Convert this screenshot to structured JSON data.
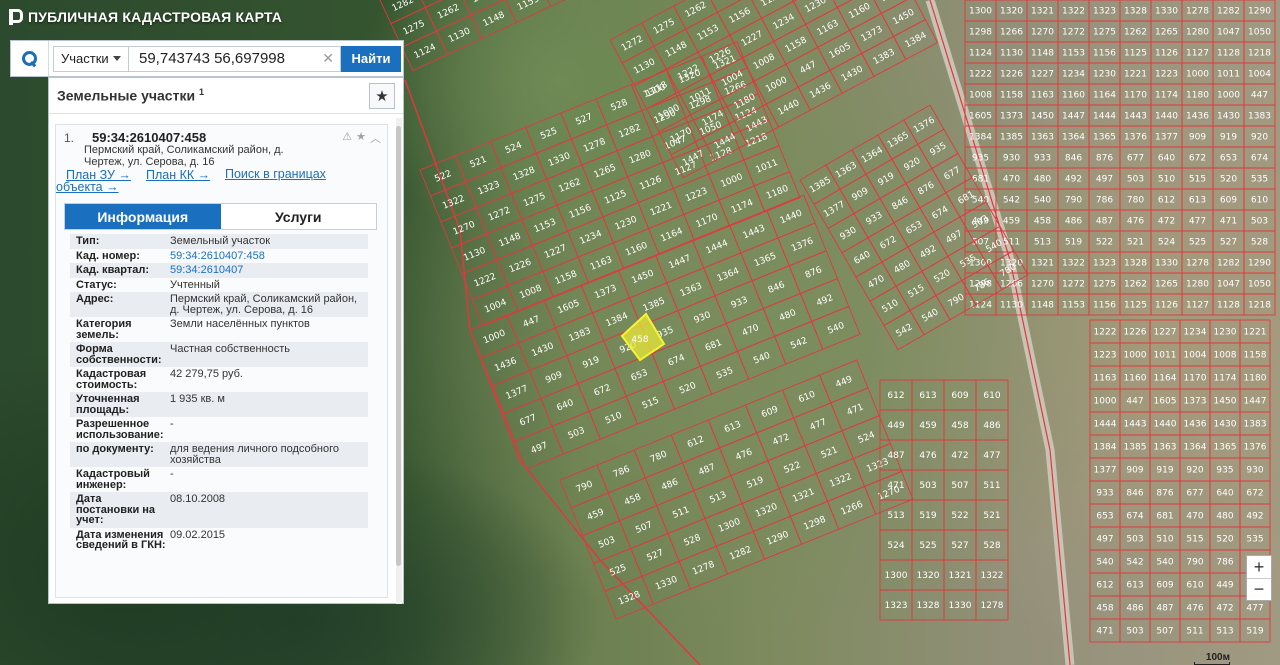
{
  "header": {
    "title": "ПУБЛИЧНАЯ КАДАСТРОВАЯ КАРТА"
  },
  "search": {
    "type_label": "Участки",
    "query": "59,743743 56,697998",
    "find_label": "Найти"
  },
  "panel": {
    "title": "Земельные участки",
    "title_sup": "1",
    "record": {
      "index": "1.",
      "cad_number": "59:34:2610407:458",
      "address": "Пермский край, Соликамский район, д. Чертеж, ул. Серова, д. 16",
      "links": [
        "План ЗУ →",
        "План КК →",
        "Поиск в границах объекта →"
      ]
    },
    "tabs": [
      "Информация",
      "Услуги"
    ],
    "properties": [
      {
        "key": "Тип:",
        "value": "Земельный участок"
      },
      {
        "key": "Кад. номер:",
        "value": "59:34:2610407:458"
      },
      {
        "key": "Кад. квартал:",
        "value": "59:34:2610407"
      },
      {
        "key": "Статус:",
        "value": "Учтенный"
      },
      {
        "key": "Адрес:",
        "value": "Пермский край, Соликамский район, д. Чертеж, ул. Серова, д. 16"
      },
      {
        "key": "Категория земель:",
        "value": "Земли населённых пунктов"
      },
      {
        "key": "Форма собственности:",
        "value": "Частная собственность"
      },
      {
        "key": "Кадастровая стоимость:",
        "value": "42 279,75 руб."
      },
      {
        "key": "Уточненная площадь:",
        "value": "1 935 кв. м"
      },
      {
        "key": "Разрешенное использование:",
        "value": "-"
      },
      {
        "key": "по документу:",
        "value": "для ведения личного подсобного хозяйства"
      },
      {
        "key": "Кадастровый инженер:",
        "value": "-"
      },
      {
        "key": "Дата постановки на учет:",
        "value": "08.10.2008"
      },
      {
        "key": "Дата изменения сведений в ГКН:",
        "value": "09.02.2015"
      }
    ]
  },
  "map": {
    "scale_label": "100м",
    "plot_labels": [
      "1300",
      "1320",
      "1321",
      "1322",
      "1323",
      "1328",
      "1330",
      "1278",
      "1282",
      "1290",
      "1298",
      "1266",
      "1270",
      "1272",
      "1275",
      "1262",
      "1265",
      "1280",
      "1047",
      "1050",
      "1124",
      "1130",
      "1148",
      "1153",
      "1156",
      "1125",
      "1126",
      "1127",
      "1128",
      "1218",
      "1222",
      "1226",
      "1227",
      "1234",
      "1230",
      "1221",
      "1223",
      "1000",
      "1011",
      "1004",
      "1008",
      "1158",
      "1163",
      "1160",
      "1164",
      "1170",
      "1174",
      "1180",
      "1000",
      "447",
      "1605",
      "1373",
      "1450",
      "1447",
      "1444",
      "1443",
      "1440",
      "1436",
      "1430",
      "1383",
      "1384",
      "1385",
      "1363",
      "1364",
      "1365",
      "1376",
      "1377",
      "909",
      "919",
      "920",
      "935",
      "930",
      "933",
      "846",
      "876",
      "677",
      "640",
      "672",
      "653",
      "674",
      "681",
      "470",
      "480",
      "492",
      "497",
      "503",
      "510",
      "515",
      "520",
      "535",
      "540",
      "542",
      "540",
      "790",
      "786",
      "780",
      "612",
      "613",
      "609",
      "610",
      "449",
      "459",
      "458",
      "486",
      "487",
      "476",
      "472",
      "477",
      "471",
      "503",
      "507",
      "511",
      "513",
      "519",
      "522",
      "521",
      "524",
      "525",
      "527",
      "528"
    ],
    "selected_plot_label": "458"
  },
  "colors": {
    "accent": "#1b6fbf",
    "plot_border": "#e0383e",
    "selected_plot": "#e8e83a"
  }
}
